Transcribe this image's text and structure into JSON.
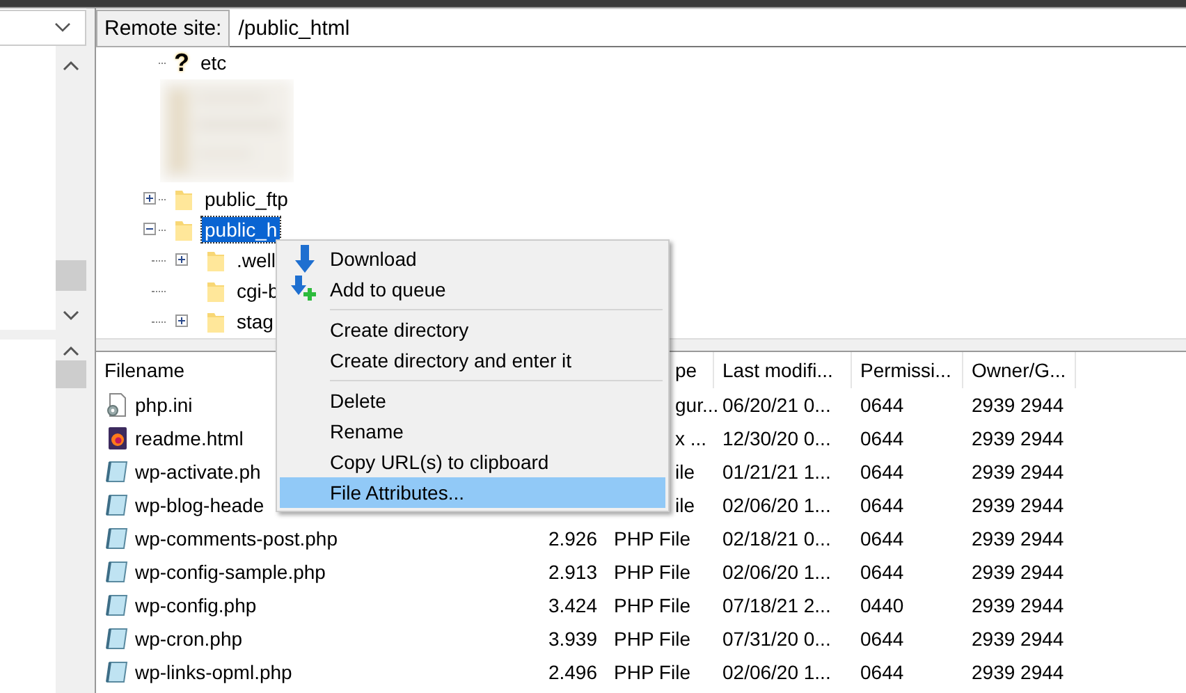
{
  "address": {
    "label": "Remote site:",
    "value": "/public_html"
  },
  "tree": [
    {
      "kind": "unknown",
      "glyph": "?",
      "name": "etc",
      "selected": false
    },
    {
      "kind": "picture"
    },
    {
      "kind": "folder",
      "name": "public_ftp",
      "selected": false,
      "expanded": false
    },
    {
      "kind": "folder",
      "name": "public_h",
      "selected": true,
      "expanded": true,
      "children": [
        {
          "kind": "folder",
          "name": ".well",
          "selected": false,
          "expanded": false
        },
        {
          "kind": "folder",
          "name": "cgi-b",
          "selected": false
        },
        {
          "kind": "folder",
          "name": "stag",
          "selected": false,
          "expanded": false
        }
      ]
    }
  ],
  "columns": [
    {
      "label": "Filename"
    },
    {
      "label": "pe",
      "covered": true
    },
    {
      "label": "Last modifi...",
      "covered": false
    },
    {
      "label": "Permissi...",
      "covered": false
    },
    {
      "label": "Owner/G...",
      "covered": false
    }
  ],
  "rows": [
    {
      "kind": "config",
      "name": "php.ini",
      "covered": true,
      "type": "gur...",
      "modified": "06/20/21 0...",
      "perms": "0644",
      "owner": "2939 2944"
    },
    {
      "kind": "html",
      "name": "readme.html",
      "covered": true,
      "type": "x ...",
      "modified": "12/30/20 0...",
      "perms": "0644",
      "owner": "2939 2944"
    },
    {
      "kind": "php",
      "name": "wp-activate.ph",
      "covered": true,
      "type": "ile",
      "modified": "01/21/21 1...",
      "perms": "0644",
      "owner": "2939 2944"
    },
    {
      "kind": "php",
      "name": "wp-blog-heade",
      "covered": true,
      "type": "ile",
      "modified": "02/06/20 1...",
      "perms": "0644",
      "owner": "2939 2944"
    },
    {
      "kind": "php",
      "name": "wp-comments-post.php",
      "covered": false,
      "size": "2.926",
      "type": "PHP File",
      "modified": "02/18/21 0...",
      "perms": "0644",
      "owner": "2939 2944"
    },
    {
      "kind": "php",
      "name": "wp-config-sample.php",
      "covered": false,
      "size": "2.913",
      "type": "PHP File",
      "modified": "02/06/20 1...",
      "perms": "0644",
      "owner": "2939 2944"
    },
    {
      "kind": "php",
      "name": "wp-config.php",
      "covered": false,
      "size": "3.424",
      "type": "PHP File",
      "modified": "07/18/21 2...",
      "perms": "0440",
      "owner": "2939 2944"
    },
    {
      "kind": "php",
      "name": "wp-cron.php",
      "covered": false,
      "size": "3.939",
      "type": "PHP File",
      "modified": "07/31/20 0...",
      "perms": "0644",
      "owner": "2939 2944"
    },
    {
      "kind": "php",
      "name": "wp-links-opml.php",
      "covered": false,
      "size": "2.496",
      "type": "PHP File",
      "modified": "02/06/20 1...",
      "perms": "0644",
      "owner": "2939 2944"
    }
  ],
  "menu": [
    {
      "kind": "download",
      "label": "Download",
      "selected": false
    },
    {
      "kind": "queue",
      "label": "Add to queue",
      "selected": false
    },
    {
      "kind": "separator"
    },
    {
      "kind": "item",
      "label": "Create directory",
      "selected": false
    },
    {
      "kind": "item",
      "label": "Create directory and enter it",
      "selected": false
    },
    {
      "kind": "separator"
    },
    {
      "kind": "item",
      "label": "Delete",
      "selected": false
    },
    {
      "kind": "item",
      "label": "Rename",
      "selected": false
    },
    {
      "kind": "item",
      "label": "Copy URL(s) to clipboard",
      "selected": false
    },
    {
      "kind": "item",
      "label": "File Attributes...",
      "selected": true
    }
  ]
}
